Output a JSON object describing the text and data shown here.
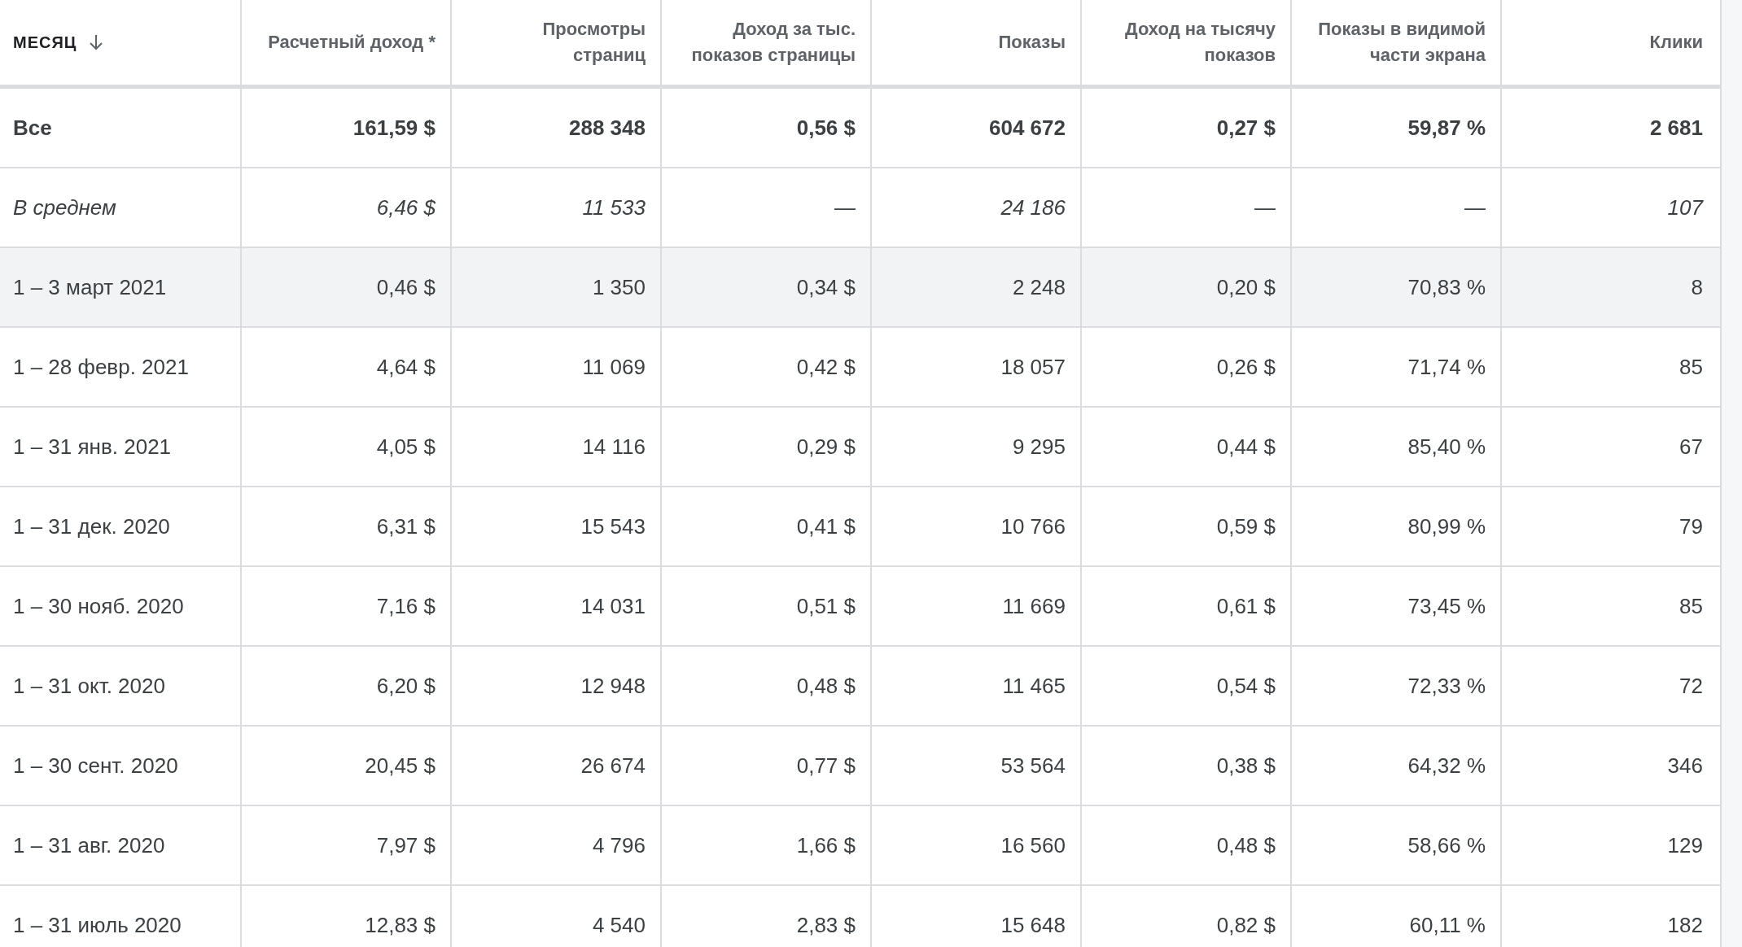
{
  "table": {
    "columns": [
      {
        "label": "МЕСЯЦ",
        "sorted": true
      },
      {
        "label": "Расчетный доход *",
        "sorted": false
      },
      {
        "label": "Просмотры страниц",
        "sorted": false
      },
      {
        "label": "Доход за тыс. показов страницы",
        "sorted": false
      },
      {
        "label": "Показы",
        "sorted": false
      },
      {
        "label": "Доход на тысячу показов",
        "sorted": false
      },
      {
        "label": "Показы в видимой части экрана",
        "sorted": false
      },
      {
        "label": "Клики",
        "sorted": false
      }
    ],
    "rows": [
      {
        "kind": "total",
        "highlighted": false,
        "cells": [
          "Все",
          "161,59 $",
          "288 348",
          "0,56 $",
          "604 672",
          "0,27 $",
          "59,87 %",
          "2 681"
        ]
      },
      {
        "kind": "average",
        "highlighted": false,
        "cells": [
          "В среднем",
          "6,46 $",
          "11 533",
          "—",
          "24 186",
          "—",
          "—",
          "107"
        ]
      },
      {
        "kind": "data",
        "highlighted": true,
        "cells": [
          "1 – 3 март 2021",
          "0,46 $",
          "1 350",
          "0,34 $",
          "2 248",
          "0,20 $",
          "70,83 %",
          "8"
        ]
      },
      {
        "kind": "data",
        "highlighted": false,
        "cells": [
          "1 – 28 февр. 2021",
          "4,64 $",
          "11 069",
          "0,42 $",
          "18 057",
          "0,26 $",
          "71,74 %",
          "85"
        ]
      },
      {
        "kind": "data",
        "highlighted": false,
        "cells": [
          "1 – 31 янв. 2021",
          "4,05 $",
          "14 116",
          "0,29 $",
          "9 295",
          "0,44 $",
          "85,40 %",
          "67"
        ]
      },
      {
        "kind": "data",
        "highlighted": false,
        "cells": [
          "1 – 31 дек. 2020",
          "6,31 $",
          "15 543",
          "0,41 $",
          "10 766",
          "0,59 $",
          "80,99 %",
          "79"
        ]
      },
      {
        "kind": "data",
        "highlighted": false,
        "cells": [
          "1 – 30 нояб. 2020",
          "7,16 $",
          "14 031",
          "0,51 $",
          "11 669",
          "0,61 $",
          "73,45 %",
          "85"
        ]
      },
      {
        "kind": "data",
        "highlighted": false,
        "cells": [
          "1 – 31 окт. 2020",
          "6,20 $",
          "12 948",
          "0,48 $",
          "11 465",
          "0,54 $",
          "72,33 %",
          "72"
        ]
      },
      {
        "kind": "data",
        "highlighted": false,
        "cells": [
          "1 – 30 сент. 2020",
          "20,45 $",
          "26 674",
          "0,77 $",
          "53 564",
          "0,38 $",
          "64,32 %",
          "346"
        ]
      },
      {
        "kind": "data",
        "highlighted": false,
        "cells": [
          "1 – 31 авг. 2020",
          "7,97 $",
          "4 796",
          "1,66 $",
          "16 560",
          "0,48 $",
          "58,66 %",
          "129"
        ]
      },
      {
        "kind": "data",
        "highlighted": false,
        "cells": [
          "1 – 31 июль 2020",
          "12,83 $",
          "4 540",
          "2,83 $",
          "15 648",
          "0,82 $",
          "60,11 %",
          "182"
        ]
      }
    ]
  }
}
